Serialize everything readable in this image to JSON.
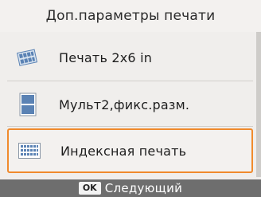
{
  "header": {
    "title": "Доп.параметры печати"
  },
  "menu": {
    "items": [
      {
        "label": "Печать 2x6 in",
        "icon": "strip-print-icon",
        "selected": false
      },
      {
        "label": "Мульт2,фикс.разм.",
        "icon": "two-up-layout-icon",
        "selected": false
      },
      {
        "label": "Индексная печать",
        "icon": "index-grid-icon",
        "selected": true
      }
    ]
  },
  "footer": {
    "ok_label": "OK",
    "next_label": "Следующий"
  },
  "colors": {
    "selection_border": "#f08a2c",
    "icon_blue": "#5a82b4",
    "footer_bg": "#6e6e6e"
  }
}
